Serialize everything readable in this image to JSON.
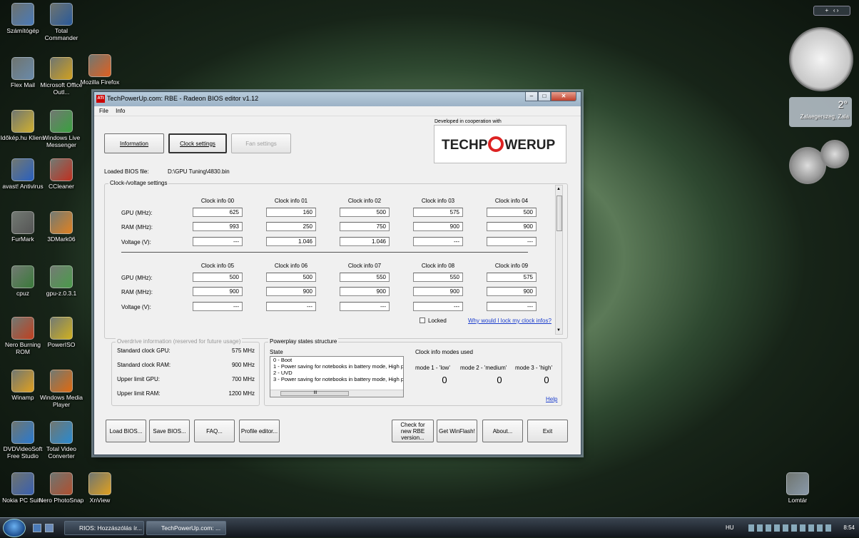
{
  "desktop": {
    "icons": [
      {
        "label": "Számítógép",
        "color": "#4a7ab8"
      },
      {
        "label": "Total Commander",
        "color": "#2a5a9a"
      },
      {
        "label": "Flex Mail",
        "color": "#6a8aaa"
      },
      {
        "label": "Microsoft Office Outl...",
        "color": "#d0a020"
      },
      {
        "label": "Mozilla Firefox",
        "color": "#e06020"
      },
      {
        "label": "Időkép.hu Kliens",
        "color": "#d0b030"
      },
      {
        "label": "Windows Live Messenger",
        "color": "#3aa040"
      },
      {
        "label": "avast! Antivirus",
        "color": "#2a60c0"
      },
      {
        "label": "CCleaner",
        "color": "#c03020"
      },
      {
        "label": "FurMark",
        "color": "#555555"
      },
      {
        "label": "3DMark06",
        "color": "#e08020"
      },
      {
        "label": "cpuz",
        "color": "#3a7a3a"
      },
      {
        "label": "gpu-z.0.3.1",
        "color": "#4a9a4a"
      },
      {
        "label": "Nero Burning ROM",
        "color": "#c04020"
      },
      {
        "label": "PowerISO",
        "color": "#d0b020"
      },
      {
        "label": "Winamp",
        "color": "#e0a020"
      },
      {
        "label": "Windows Media Player",
        "color": "#e06a10"
      },
      {
        "label": "DVDVideoSoft Free Studio",
        "color": "#2a7ad0"
      },
      {
        "label": "Total Video Converter",
        "color": "#2a8ad0"
      },
      {
        "label": "Nokia PC Suite",
        "color": "#3a60b0"
      },
      {
        "label": "Nero PhotoSnap",
        "color": "#b05030"
      },
      {
        "label": "XnView",
        "color": "#e0a020"
      },
      {
        "label": "Lomtár",
        "color": "#8a9aaa"
      }
    ],
    "weather": {
      "temp": "2°",
      "location": "Zalaegerszeg, Zala"
    }
  },
  "window": {
    "title": "TechPowerUp.com: RBE - Radeon BIOS editor v1.12",
    "app_icon": "ATI",
    "menu": [
      "File",
      "Info"
    ],
    "tabs": {
      "information": "Information",
      "clock": "Clock settings",
      "fan": "Fan settings"
    },
    "logo": {
      "caption": "Developed in cooperation with",
      "text_a": "TECHP",
      "text_b": "WERUP"
    },
    "bios": {
      "label": "Loaded BIOS file:",
      "path": "D:\\GPU Tuning\\4830.bin"
    },
    "clock": {
      "group_label": "Clock-/voltage settings",
      "row_labels": {
        "gpu": "GPU (MHz):",
        "ram": "RAM (MHz):",
        "voltage": "Voltage (V):"
      },
      "set1": [
        {
          "header": "Clock info 00",
          "gpu": "625",
          "ram": "993",
          "voltage": "---"
        },
        {
          "header": "Clock info 01",
          "gpu": "160",
          "ram": "250",
          "voltage": "1.046"
        },
        {
          "header": "Clock info 02",
          "gpu": "500",
          "ram": "750",
          "voltage": "1.046"
        },
        {
          "header": "Clock info 03",
          "gpu": "575",
          "ram": "900",
          "voltage": "---"
        },
        {
          "header": "Clock info 04",
          "gpu": "500",
          "ram": "900",
          "voltage": "---"
        }
      ],
      "set2": [
        {
          "header": "Clock info 05",
          "gpu": "500",
          "ram": "900",
          "voltage": "---"
        },
        {
          "header": "Clock info 06",
          "gpu": "500",
          "ram": "900",
          "voltage": "---"
        },
        {
          "header": "Clock info 07",
          "gpu": "550",
          "ram": "900",
          "voltage": "---"
        },
        {
          "header": "Clock info 08",
          "gpu": "550",
          "ram": "900",
          "voltage": "---"
        },
        {
          "header": "Clock info 09",
          "gpu": "575",
          "ram": "900",
          "voltage": "---"
        }
      ],
      "locked_label": "Locked",
      "lock_link": "Why would I lock my clock infos?"
    },
    "overdrive": {
      "label": "Overdrive information (reserved for future usage)",
      "rows": [
        {
          "label": "Standard clock GPU:",
          "value": "575 MHz"
        },
        {
          "label": "Standard clock RAM:",
          "value": "900 MHz"
        },
        {
          "label": "Upper limit GPU:",
          "value": "700 MHz"
        },
        {
          "label": "Upper limit RAM:",
          "value": "1200 MHz"
        }
      ]
    },
    "powerplay": {
      "label": "Powerplay states structure",
      "state_header": "State",
      "states": [
        "0 - Boot",
        "1 - Power saving for notebooks in battery mode, High p",
        "2 - UVD",
        "3 - Power saving for notebooks in battery mode, High p"
      ],
      "modes_header": "Clock info modes used",
      "modes": [
        {
          "label": "mode 1 - 'low'",
          "value": "0"
        },
        {
          "label": "mode 2 - 'medium'",
          "value": "0"
        },
        {
          "label": "mode 3 - 'high'",
          "value": "0"
        }
      ],
      "help": "Help"
    },
    "buttons": {
      "load": "Load BIOS...",
      "save": "Save BIOS...",
      "faq": "FAQ...",
      "profile": "Profile editor...",
      "check": "Check for new RBE version...",
      "winflash": "Get WinFlash!",
      "about": "About...",
      "exit": "Exit"
    }
  },
  "taskbar": {
    "items": [
      "RIOS: Hozzászólás ír...",
      "TechPowerUp.com: ..."
    ],
    "lang": "HU",
    "time": "8:54"
  }
}
